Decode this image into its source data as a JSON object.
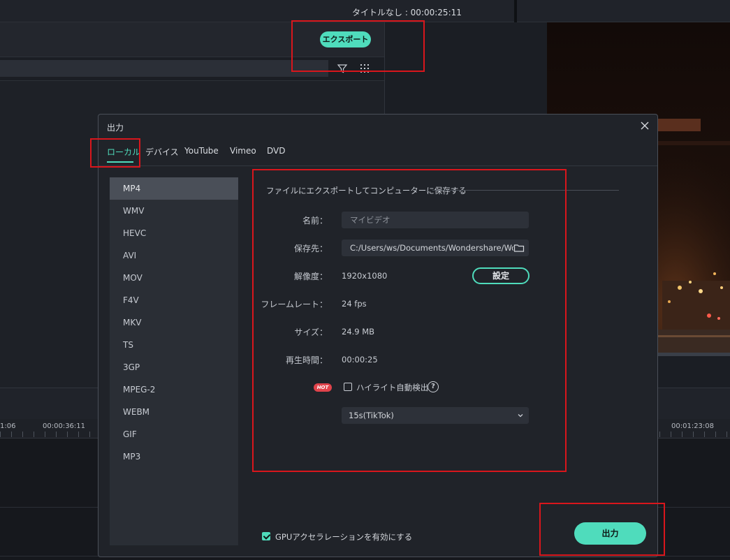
{
  "app": {
    "title": "タイトルなし : 00:00:25:11",
    "export_button": "エクスポート"
  },
  "timeline": {
    "ruler_labels": [
      "1:06",
      "00:00:36:11",
      "00:01:23:08"
    ]
  },
  "dialog": {
    "title": "出力",
    "tabs": [
      {
        "label": "ローカル",
        "active": true
      },
      {
        "label": "デバイス",
        "active": false
      },
      {
        "label": "YouTube",
        "active": false
      },
      {
        "label": "Vimeo",
        "active": false
      },
      {
        "label": "DVD",
        "active": false
      }
    ],
    "formats": [
      "MP4",
      "WMV",
      "HEVC",
      "AVI",
      "MOV",
      "F4V",
      "MKV",
      "TS",
      "3GP",
      "MPEG-2",
      "WEBM",
      "GIF",
      "MP3"
    ],
    "selected_format": "MP4",
    "section_title": "ファイルにエクスポートしてコンピューターに保存する",
    "name": {
      "label": "名前：",
      "placeholder": "マイビデオ"
    },
    "save_to": {
      "label": "保存先：",
      "value": "C:/Users/ws/Documents/Wondershare/Wo"
    },
    "resolution": {
      "label": "解像度：",
      "value": "1920x1080",
      "settings_button": "設定"
    },
    "framerate": {
      "label": "フレームレート：",
      "value": "24 fps"
    },
    "size": {
      "label": "サイズ：",
      "value": "24.9 MB"
    },
    "duration": {
      "label": "再生時間：",
      "value": "00:00:25"
    },
    "highlight": {
      "badge": "HOT",
      "label": "ハイライト自動検出",
      "checked": false,
      "help": "?"
    },
    "highlight_length": {
      "selected": "15s(TikTok)"
    },
    "gpu": {
      "label": "GPUアクセラレーションを有効にする",
      "checked": true
    },
    "export_button": "出力"
  },
  "colors": {
    "accent": "#4fdcbc",
    "annotation": "#d9161c",
    "hot_badge": "#e0434b"
  }
}
